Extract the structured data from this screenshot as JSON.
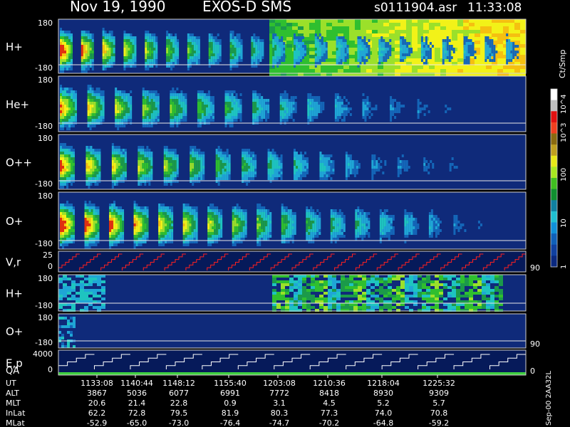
{
  "header": {
    "date": "Nov 19, 1990",
    "instrument": "EXOS-D SMS",
    "file": "s0111904.asr",
    "time": "11:33:08"
  },
  "colorbar": {
    "label": "Ct/Smp",
    "ticks": [
      "10^4",
      "10^3",
      "100",
      "10",
      "1"
    ]
  },
  "chart_data": {
    "type": "heatmap",
    "title": "",
    "panels": [
      {
        "label": "H+",
        "ymax": "180",
        "ymin": "-180",
        "kind": "spectrogram",
        "cycles": 22,
        "strength": [
          1.0,
          0.9,
          0.8,
          0.7,
          0.65,
          0.6,
          0.55,
          0.5,
          0.5,
          0.45,
          0.45,
          0.4,
          0.4,
          0.4,
          0.35,
          0.35,
          0.3,
          0.3,
          0.3,
          0.3,
          0.3,
          0.3
        ],
        "background": "saturated-right"
      },
      {
        "label": "He+",
        "ymax": "180",
        "ymin": "-180",
        "kind": "spectrogram",
        "cycles": 17,
        "strength": [
          0.85,
          0.75,
          0.7,
          0.65,
          0.6,
          0.55,
          0.5,
          0.45,
          0.4,
          0.35,
          0.3,
          0.25,
          0.22,
          0.2,
          0.15,
          0.12,
          0.1
        ]
      },
      {
        "label": "O++",
        "ymax": "180",
        "ymin": "-180",
        "kind": "spectrogram",
        "cycles": 18,
        "strength": [
          0.9,
          0.8,
          0.75,
          0.7,
          0.65,
          0.6,
          0.55,
          0.5,
          0.45,
          0.4,
          0.35,
          0.3,
          0.25,
          0.22,
          0.2,
          0.16,
          0.12,
          0.08
        ]
      },
      {
        "label": "O+",
        "ymax": "180",
        "ymin": "-180",
        "kind": "spectrogram",
        "cycles": 19,
        "strength": [
          1.0,
          0.95,
          0.9,
          0.85,
          0.8,
          0.75,
          0.7,
          0.65,
          0.6,
          0.55,
          0.5,
          0.45,
          0.42,
          0.38,
          0.33,
          0.28,
          0.22,
          0.16,
          0.1
        ]
      },
      {
        "label": "V,r",
        "ymax": "25",
        "ymin": "0",
        "right_label": "90",
        "kind": "staircase",
        "color": "#ff2020",
        "cycles": 22
      },
      {
        "label": "H+",
        "ymax": "180",
        "ymin": "-180",
        "kind": "spectrogram2",
        "active_from": 0.45
      },
      {
        "label": "O+",
        "ymax": "180",
        "ymin": "-180",
        "right_label": "90",
        "kind": "spectrogram3"
      },
      {
        "label": "E,p",
        "label2": "QA",
        "ymax": "4000",
        "ymin": "0",
        "right_label": "0",
        "kind": "staircase2",
        "color": "#ffffff",
        "cycles": 13
      }
    ],
    "x_axis": {
      "rows": [
        {
          "name": "UT",
          "values": [
            "1133:08",
            "1140:44",
            "1148:12",
            "1155:40",
            "1203:08",
            "1210:36",
            "1218:04",
            "1225:32"
          ]
        },
        {
          "name": "ALT",
          "values": [
            "3867",
            "5036",
            "6077",
            "6991",
            "7772",
            "8418",
            "8930",
            "9309"
          ]
        },
        {
          "name": "MLT",
          "values": [
            "20.6",
            "21.4",
            "22.8",
            "0.9",
            "3.1",
            "4.5",
            "5.2",
            "5.7"
          ]
        },
        {
          "name": "InLat",
          "values": [
            "62.2",
            "72.8",
            "79.5",
            "81.9",
            "80.3",
            "77.3",
            "74.0",
            "70.8"
          ]
        },
        {
          "name": "MLat",
          "values": [
            "-52.9",
            "-65.0",
            "-73.0",
            "-76.4",
            "-74.7",
            "-70.2",
            "-64.8",
            "-59.2"
          ]
        }
      ]
    },
    "side_note": "Sep-00 2AA32L"
  }
}
